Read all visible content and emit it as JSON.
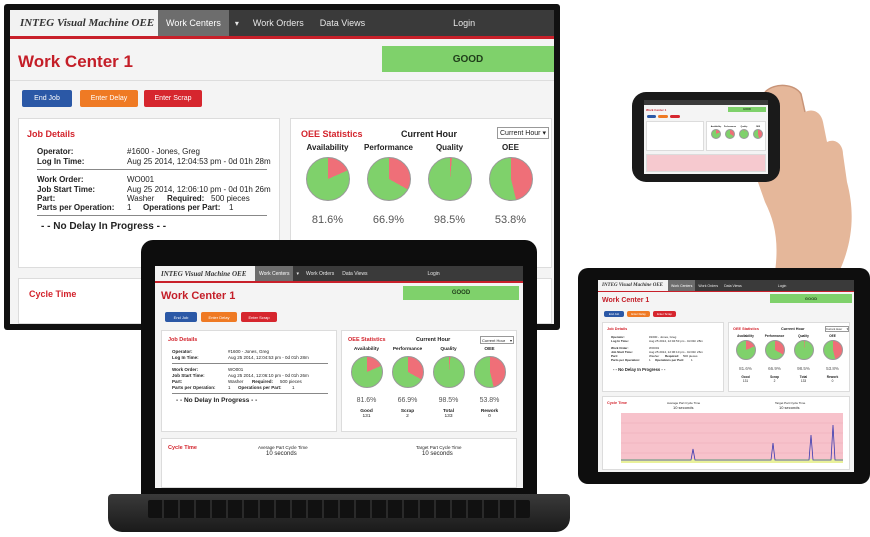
{
  "app": {
    "brand": "INTEG Visual Machine OEE",
    "nav": [
      "Work Centers",
      "Work Orders",
      "Data Views",
      "Login"
    ],
    "nav_caret": "▾",
    "work_center": "Work Center 1",
    "status": "GOOD",
    "buttons": {
      "end_job": "End Job",
      "enter_delay": "Enter Delay",
      "enter_scrap": "Enter Scrap"
    }
  },
  "job": {
    "title": "Job Details",
    "operator_label": "Operator:",
    "operator": "#1600 - Jones, Greg",
    "login_label": "Log In Time:",
    "login": "Aug 25 2014, 12:04:53 pm - 0d 01h 28m",
    "wo_label": "Work Order:",
    "wo": "WO001",
    "start_label": "Job Start Time:",
    "start": "Aug 25 2014, 12:06:10 pm - 0d 01h 26m",
    "part_label": "Part:",
    "part": "Washer",
    "required_label": "Required:",
    "required": "500 pieces",
    "ppo_label": "Parts per Operation:",
    "ppo": "1",
    "opp_label": "Operations per Part:",
    "opp": "1",
    "delay": "- - No Delay In Progress - -"
  },
  "oee": {
    "title": "OEE Statistics",
    "period_heading": "Current Hour",
    "period_select": "Current Hour",
    "metrics": [
      {
        "name": "Availability",
        "value": "81.6%",
        "fraction": 0.816
      },
      {
        "name": "Performance",
        "value": "66.9%",
        "fraction": 0.669
      },
      {
        "name": "Quality",
        "value": "98.5%",
        "fraction": 0.985
      },
      {
        "name": "OEE",
        "value": "53.8%",
        "fraction": 0.538
      }
    ],
    "counts": [
      {
        "name": "Good",
        "value": "131"
      },
      {
        "name": "Scrap",
        "value": "2"
      },
      {
        "name": "Total",
        "value": "133"
      },
      {
        "name": "Rework",
        "value": "0"
      }
    ]
  },
  "cycle": {
    "title": "Cycle Time",
    "avg_label": "Average Part Cycle Time",
    "avg_value": "10 seconds",
    "target_label": "Target Part Cycle Time",
    "target_value": "10 seconds"
  },
  "colors": {
    "good": "#7fd16b",
    "bad": "#ef6f78",
    "nav": "#3a3a3a",
    "accent": "#c8202a",
    "btn_blue": "#2b58a6",
    "btn_orange": "#ef7a24",
    "btn_red": "#d6262e"
  }
}
